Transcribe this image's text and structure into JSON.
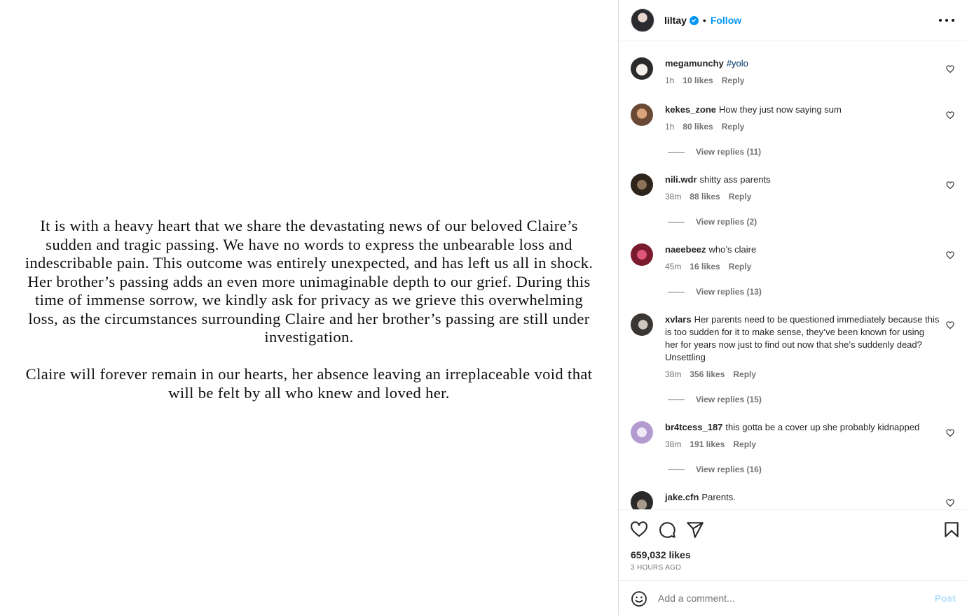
{
  "post": {
    "paragraphs": [
      "It is with a heavy heart that we share the devastating news of our beloved Claire’s sudden and tragic passing. We have no words to express the unbearable loss and indescribable pain. This outcome was entirely unexpected, and has left us all in shock. Her brother’s passing adds an even more unimaginable depth to our grief. During this time of immense sorrow, we kindly ask for privacy as we grieve this overwhelming loss, as the circumstances surrounding Claire and her brother’s passing are still under investigation.",
      "Claire will forever remain in our hearts, her absence leaving an irreplaceable void that will be felt by all who knew and loved her."
    ]
  },
  "header": {
    "username": "liltay",
    "separator": "•",
    "follow_label": "Follow"
  },
  "comments": [
    {
      "username": "megamunchy",
      "text": "",
      "hashtag": "#yolo",
      "time": "1h",
      "likes": "10 likes",
      "reply": "Reply"
    },
    {
      "username": "kekes_zone",
      "text": "How they just now saying sum",
      "time": "1h",
      "likes": "80 likes",
      "reply": "Reply",
      "view_replies": "View replies (11)"
    },
    {
      "username": "nili.wdr",
      "text": "shitty ass parents",
      "time": "38m",
      "likes": "88 likes",
      "reply": "Reply",
      "view_replies": "View replies (2)"
    },
    {
      "username": "naeebeez",
      "text": "who’s claire",
      "time": "45m",
      "likes": "16 likes",
      "reply": "Reply",
      "view_replies": "View replies (13)"
    },
    {
      "username": "xvlars",
      "text": "Her parents need to be questioned immediately because this is too sudden for it to make sense, they’ve been known for using her for years now just to find out now that she’s suddenly dead? Unsettling",
      "time": "38m",
      "likes": "356 likes",
      "reply": "Reply",
      "view_replies": "View replies (15)"
    },
    {
      "username": "br4tcess_187",
      "text": "this gotta be a cover up she probably kidnapped",
      "time": "38m",
      "likes": "191 likes",
      "reply": "Reply",
      "view_replies": "View replies (16)"
    },
    {
      "username": "jake.cfn",
      "text": "Parents."
    }
  ],
  "footer": {
    "likes": "659,032 likes",
    "time": "3 HOURS AGO",
    "comment_placeholder": "Add a comment...",
    "post_label": "Post"
  },
  "icons": {
    "header": [
      "avatar",
      "verified-badge-icon",
      "more-options-icon"
    ],
    "actions": [
      "heart-icon",
      "comment-icon",
      "share-icon",
      "bookmark-icon"
    ],
    "input": "emoji-icon"
  },
  "colors": {
    "accent": "#0095f6",
    "post_disabled": "#b2dffc",
    "muted_text": "#737373"
  }
}
